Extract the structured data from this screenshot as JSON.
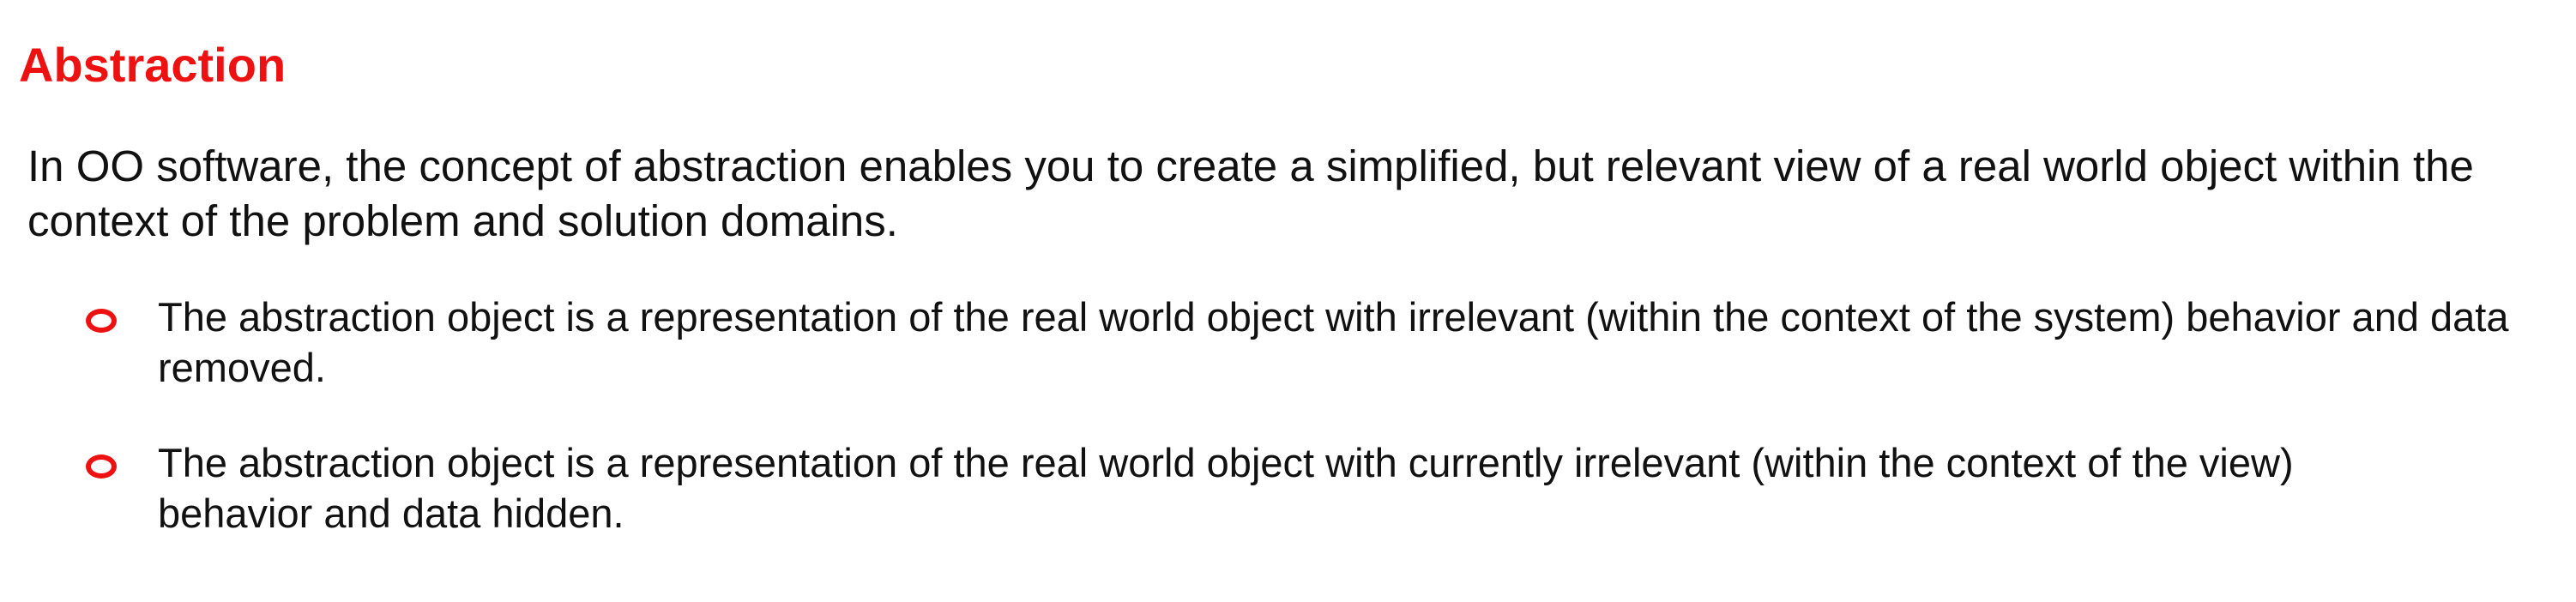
{
  "heading": "Abstraction",
  "intro": "In OO software, the concept of abstraction enables you to create a simplified, but relevant view of a real world object within the context of the problem and solution domains.",
  "bullets": [
    "The abstraction object is a representation of the real world object with irrelevant (within the context of the system) behavior and data removed.",
    "The abstraction object is a representation of the real world object with currently irrelevant (within the context of the view) behavior and data hidden."
  ],
  "colors": {
    "heading": "#ee1111",
    "bullet_marker": "#ee1111",
    "text": "#111111",
    "background": "#ffffff"
  },
  "icons": {
    "bullet_marker": "hollow-red-circle-icon"
  }
}
